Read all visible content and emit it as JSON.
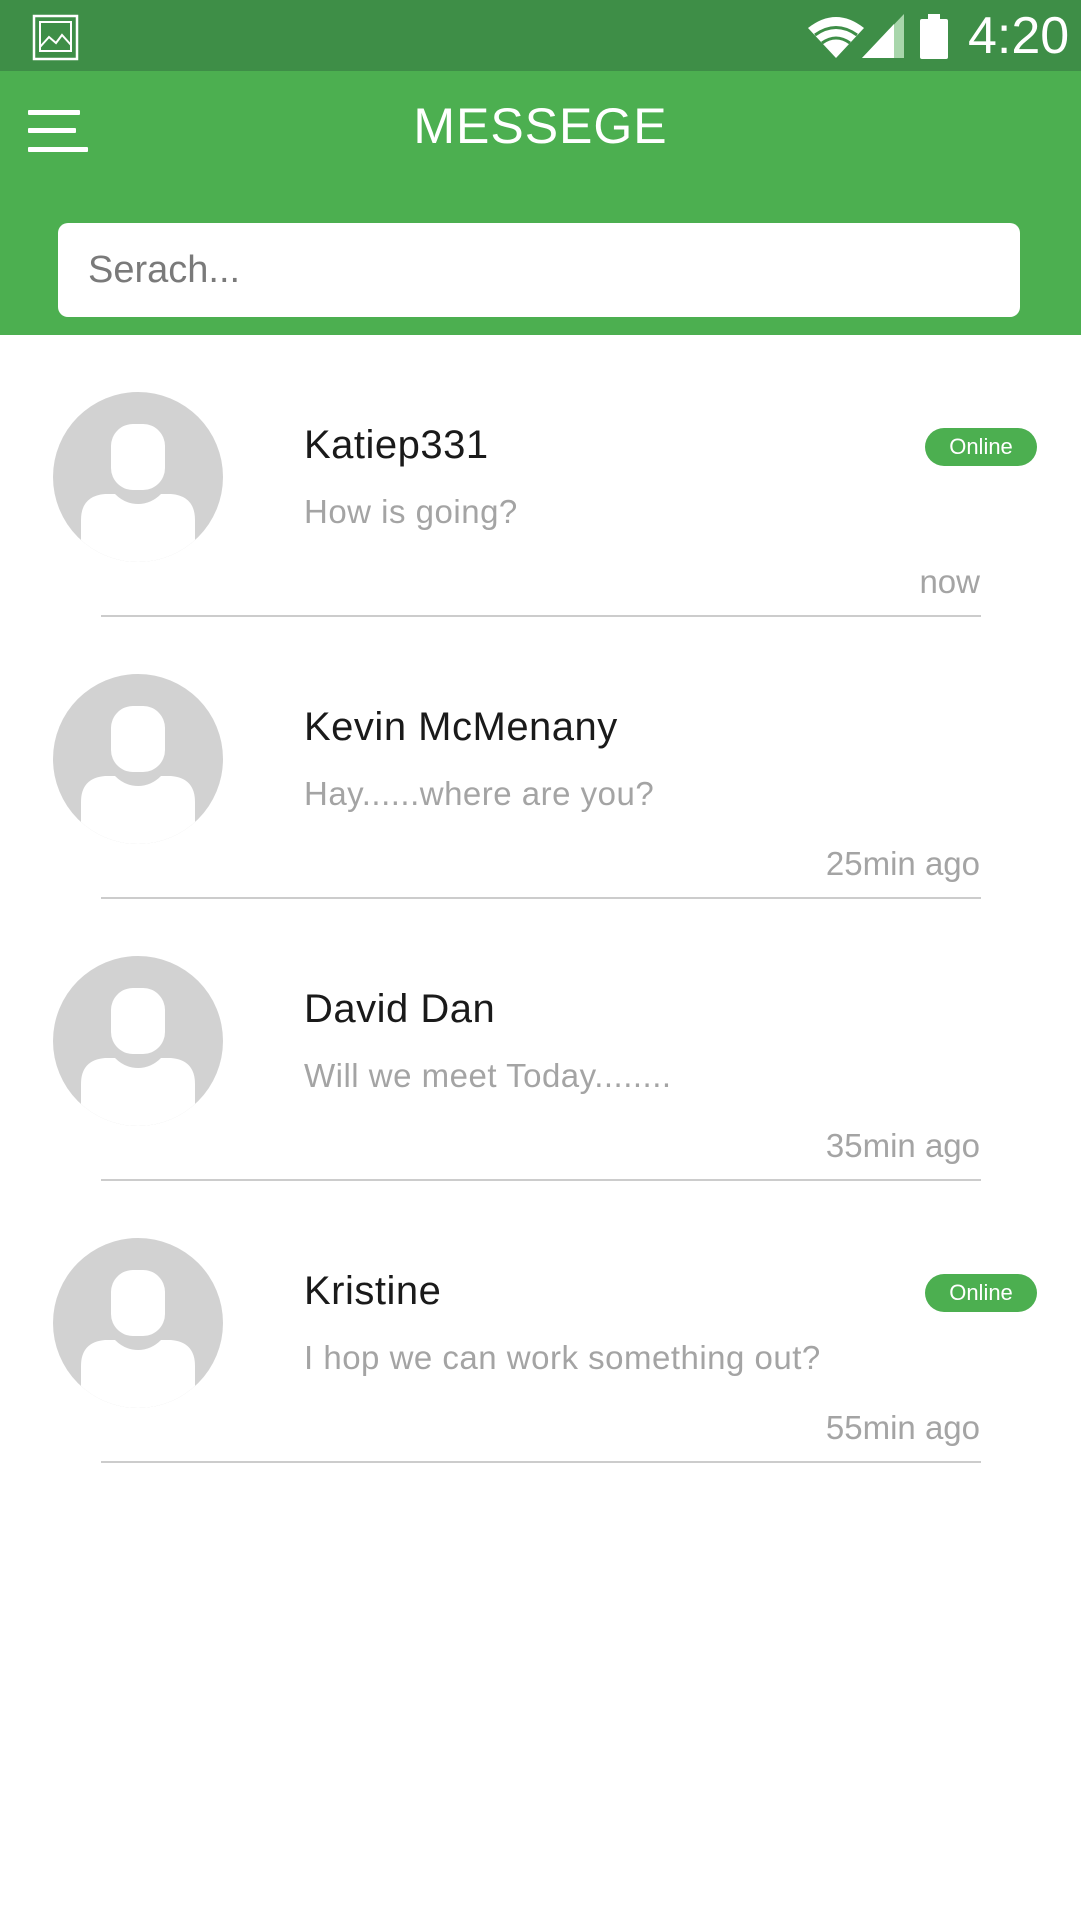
{
  "status_bar": {
    "time": "4:20",
    "icons": [
      "gallery-icon",
      "wifi-icon",
      "signal-icon",
      "battery-icon"
    ]
  },
  "header": {
    "title": "MESSEGE",
    "menu_icon": "hamburger-menu-icon",
    "background_color": "#4caf50",
    "status_bar_color": "#3e8e47"
  },
  "search": {
    "placeholder": "Serach...",
    "value": ""
  },
  "conversations": [
    {
      "name": "Katiep331",
      "message": "How is going?",
      "time": "now",
      "status": "Online"
    },
    {
      "name": "Kevin McMenany",
      "message": "Hay......where are you?",
      "time": "25min ago",
      "status": ""
    },
    {
      "name": "David Dan",
      "message": "Will we meet Today........",
      "time": "35min ago",
      "status": ""
    },
    {
      "name": "Kristine",
      "message": "I hop we can work something out?",
      "time": "55min ago",
      "status": "Online"
    }
  ]
}
